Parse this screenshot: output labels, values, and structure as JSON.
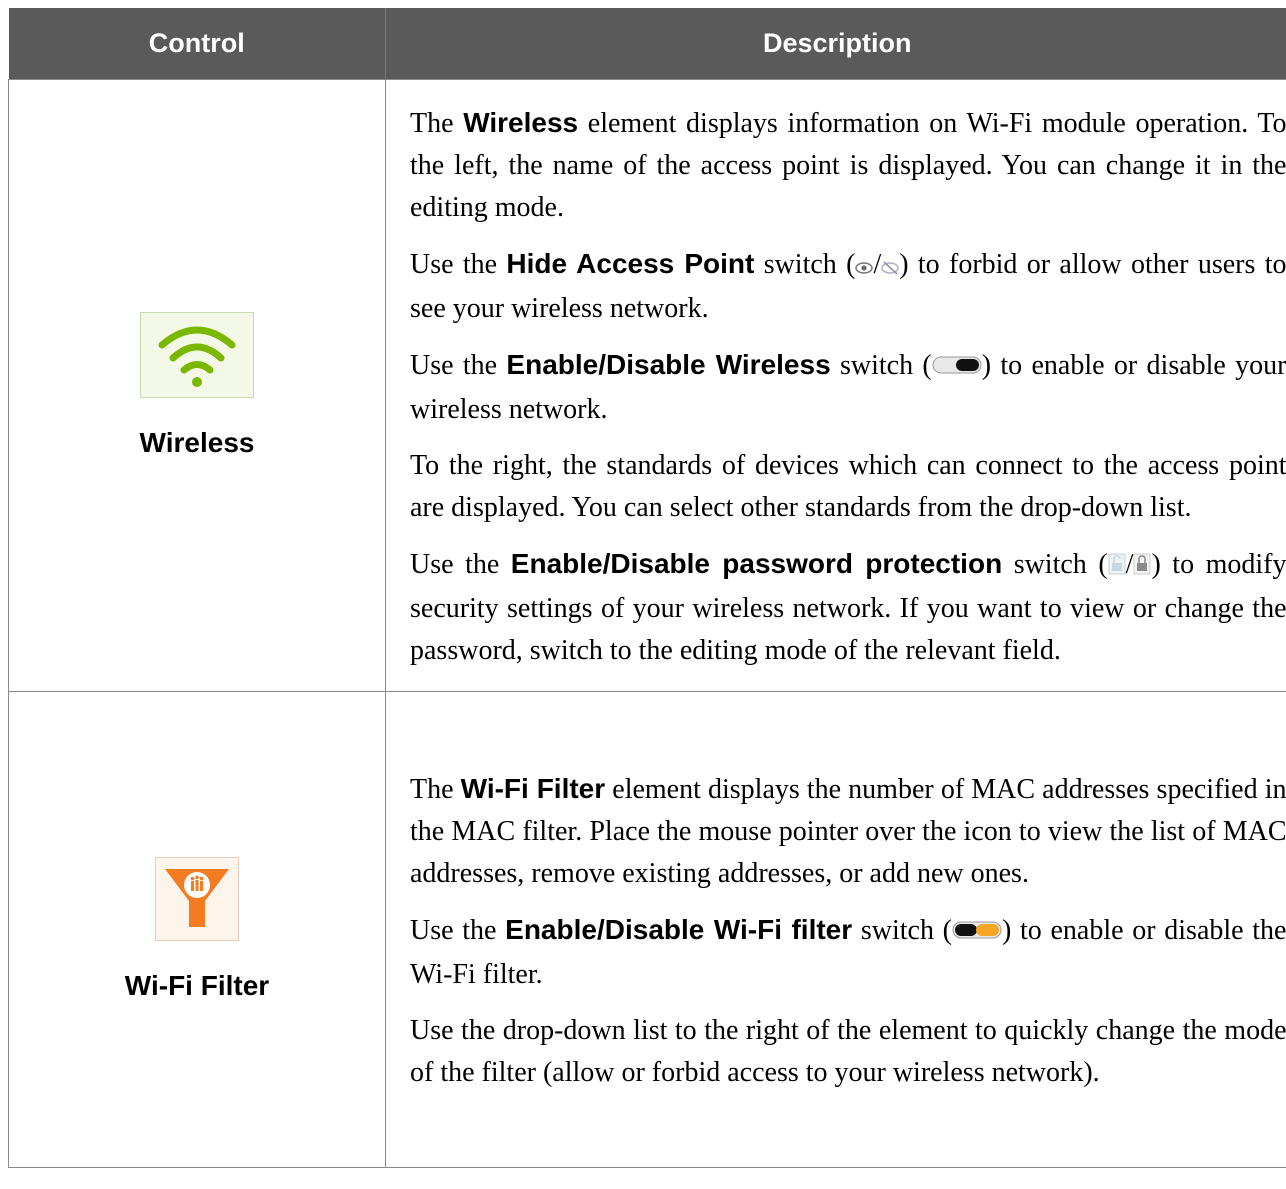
{
  "table": {
    "headers": {
      "control": "Control",
      "description": "Description"
    },
    "rows": [
      {
        "control_label": "Wireless",
        "icon": "wifi-icon",
        "icon_color": "#7ab800",
        "paragraphs": [
          {
            "pre": "The ",
            "bold": "Wireless",
            "post": " element displays information on Wi-Fi module operation. To the left, the name of the access point is displayed. You can change it in the editing mode."
          },
          {
            "pre": "Use the ",
            "bold": "Hide Access Point",
            "post_a": " switch (",
            "post_b": ") to forbid or allow other users to see your wireless network.",
            "inline_icons": [
              "eye-icon",
              "eye-crossed-icon"
            ]
          },
          {
            "pre": "Use the ",
            "bold": "Enable/Disable Wireless",
            "post_a": " switch (",
            "post_b": ") to enable or disable your wireless network.",
            "inline_icons": [
              "toggle-switch-icon"
            ]
          },
          {
            "text": "To the right, the standards of devices which can connect to the access point are displayed. You can select other standards from the drop-down list."
          },
          {
            "pre": "Use the ",
            "bold": "Enable/Disable password protection",
            "post_a": " switch (",
            "post_b": ") to modify security settings of your wireless network. If you want to view or change the password, switch to the editing mode of the relevant field.",
            "inline_icons": [
              "lock-open-icon",
              "lock-closed-icon"
            ]
          }
        ]
      },
      {
        "control_label": "Wi-Fi Filter",
        "icon": "wifi-filter-icon",
        "icon_color": "#f47b20",
        "paragraphs": [
          {
            "pre": "The ",
            "bold": "Wi-Fi Filter",
            "post": " element displays the number of MAC addresses specified in the MAC filter. Place the mouse pointer over the icon to view the list of MAC addresses, remove existing addresses, or add new ones."
          },
          {
            "pre": "Use the ",
            "bold": "Enable/Disable Wi-Fi filter",
            "post_a": " switch (",
            "post_b": ") to enable or disable the Wi-Fi filter.",
            "inline_icons": [
              "toggle-switch-orange-icon"
            ]
          },
          {
            "text": "Use the drop-down list to the right of the element to quickly change the mode of the filter (allow or forbid access to your wireless network)."
          }
        ]
      }
    ]
  }
}
